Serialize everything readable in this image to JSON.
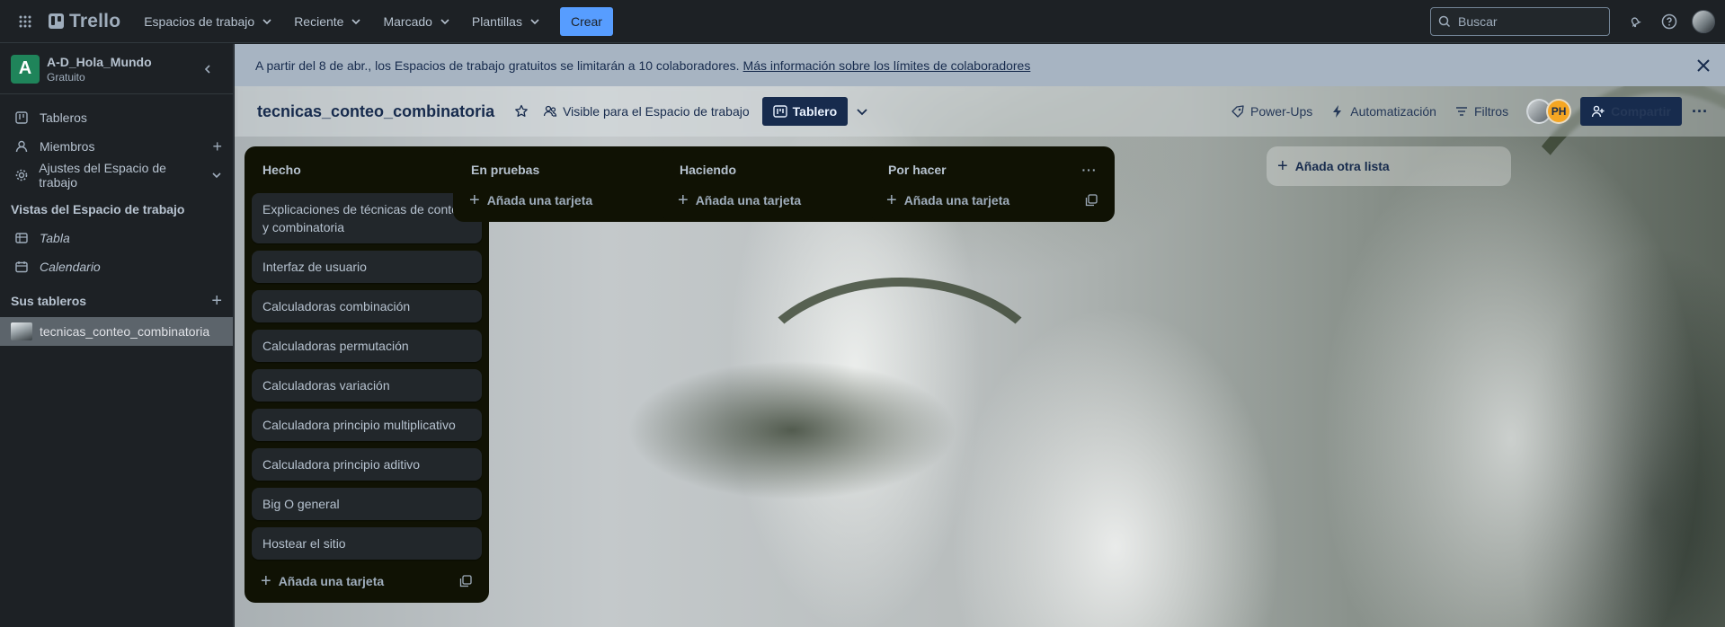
{
  "topbar": {
    "brand": "Trello",
    "nav": [
      {
        "label": "Espacios de trabajo"
      },
      {
        "label": "Reciente"
      },
      {
        "label": "Marcado"
      },
      {
        "label": "Plantillas"
      }
    ],
    "create_label": "Crear",
    "search_placeholder": "Buscar"
  },
  "sidebar": {
    "workspace_initial": "A",
    "workspace_name": "A-D_Hola_Mundo",
    "workspace_plan": "Gratuito",
    "items": [
      {
        "label": "Tableros"
      },
      {
        "label": "Miembros"
      },
      {
        "label": "Ajustes del Espacio de trabajo"
      }
    ],
    "views_heading": "Vistas del Espacio de trabajo",
    "views": [
      {
        "label": "Tabla"
      },
      {
        "label": "Calendario"
      }
    ],
    "boards_heading": "Sus tableros",
    "boards": [
      {
        "label": "tecnicas_conteo_combinatoria"
      }
    ]
  },
  "banner": {
    "text": "A partir del 8 de abr., los Espacios de trabajo gratuitos se limitarán a 10 colaboradores.",
    "link": "Más información sobre los límites de colaboradores"
  },
  "board_header": {
    "title": "tecnicas_conteo_combinatoria",
    "visibility": "Visible para el Espacio de trabajo",
    "view_label": "Tablero",
    "powerups": "Power-Ups",
    "automation": "Automatización",
    "filters": "Filtros",
    "member_initials": "PH",
    "share": "Compartir"
  },
  "lists": [
    {
      "title": "Hecho",
      "cards": [
        "Explicaciones de técnicas de conteo y combinatoria",
        "Interfaz de usuario",
        "Calculadoras combinación",
        "Calculadoras permutación",
        "Calculadoras variación",
        "Calculadora principio multiplicativo",
        "Calculadora principio aditivo",
        "Big O general",
        "Hostear el sitio"
      ],
      "add_card": "Añada una tarjeta"
    },
    {
      "title": "En pruebas",
      "cards": [],
      "add_card": "Añada una tarjeta"
    },
    {
      "title": "Haciendo",
      "cards": [],
      "add_card": "Añada una tarjeta"
    },
    {
      "title": "Por hacer",
      "cards": [],
      "add_card": "Añada una tarjeta"
    }
  ],
  "add_list_label": "Añada otra lista"
}
